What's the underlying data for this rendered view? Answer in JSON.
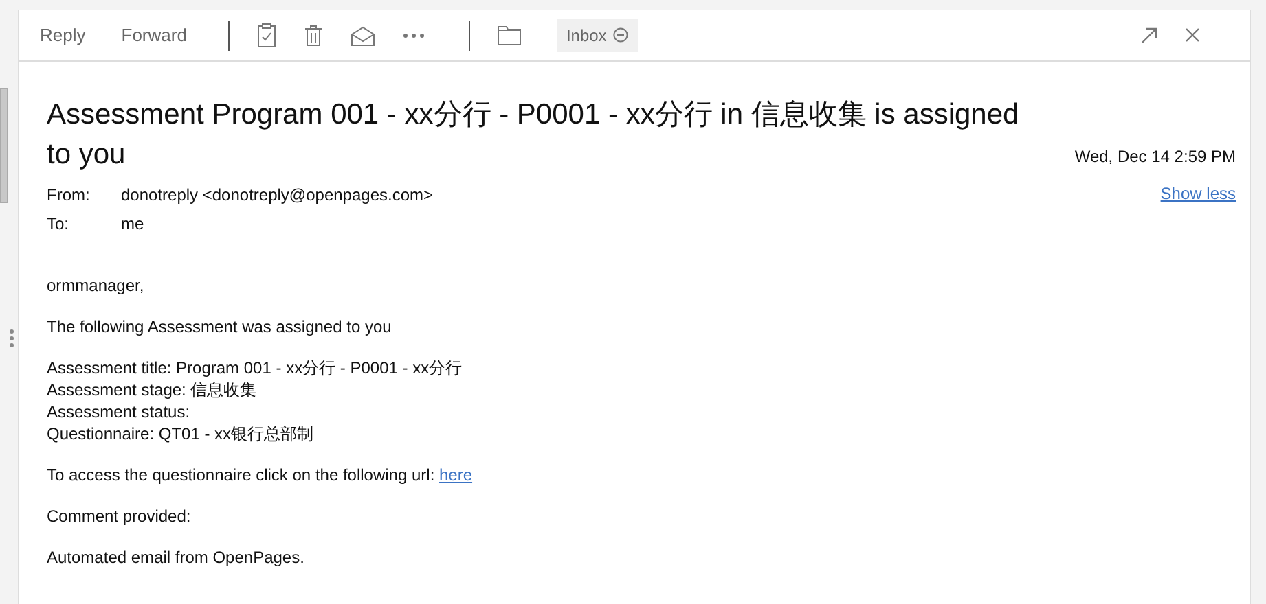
{
  "toolbar": {
    "actions": [
      "Reply",
      "Forward"
    ],
    "folder": "Inbox"
  },
  "message": {
    "subject": "Assessment Program 001 - xx分行 - P0001 - xx分行 in 信息收集 is assigned to you",
    "date": "Wed, Dec 14 2:59 PM",
    "toggle": "Show less",
    "headers": [
      {
        "label": "From:",
        "value": "donotreply <donotreply@openpages.com>"
      },
      {
        "label": "To:",
        "value": "me"
      }
    ],
    "body": [
      {
        "lines": [
          "ormmanager,"
        ]
      },
      {
        "lines": [
          "The following Assessment was assigned to you"
        ]
      },
      {
        "lines": [
          "Assessment title: Program 001 - xx分行 - P0001 - xx分行",
          "Assessment stage: 信息收集",
          "Assessment status:",
          "Questionnaire: QT01 - xx银行总部制"
        ]
      },
      {
        "lines": [
          "To access the questionnaire click on the following url:"
        ],
        "link": "here"
      },
      {
        "lines": [
          "Comment provided:"
        ]
      },
      {
        "lines": [
          "Automated email from OpenPages."
        ]
      }
    ]
  }
}
